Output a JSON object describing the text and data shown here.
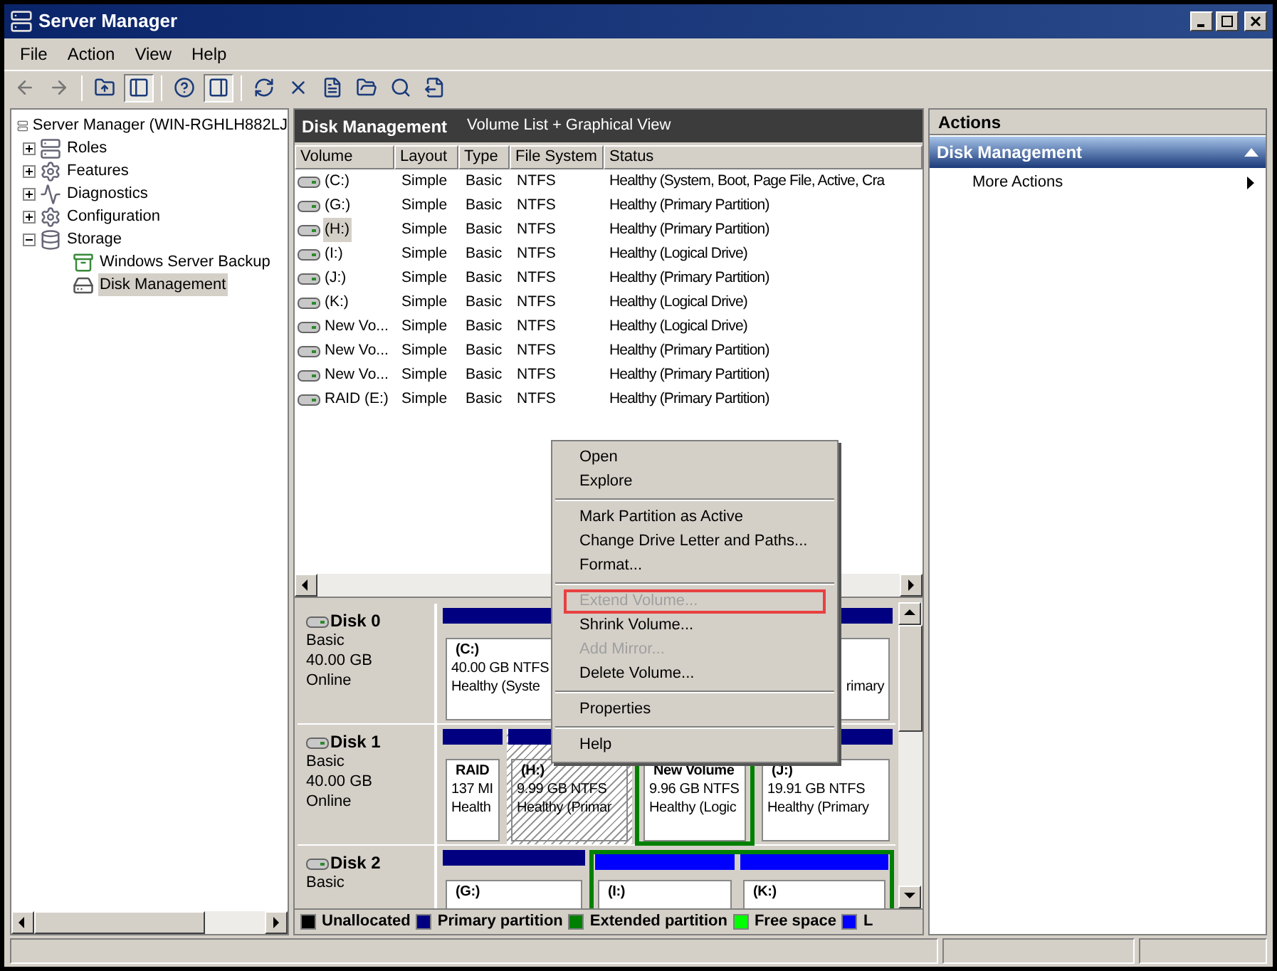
{
  "window": {
    "title": "Server Manager"
  },
  "menu_bar": [
    "File",
    "Action",
    "View",
    "Help"
  ],
  "toolbar": [
    {
      "kind": "back",
      "pressed": false
    },
    {
      "kind": "forward",
      "pressed": false
    },
    {
      "kind": "up",
      "pressed": false
    },
    {
      "kind": "tree",
      "pressed": true
    },
    {
      "kind": "help",
      "pressed": false
    },
    {
      "kind": "pane",
      "pressed": true
    },
    {
      "kind": "refresh",
      "pressed": false
    },
    {
      "kind": "delete",
      "pressed": false
    },
    {
      "kind": "properties",
      "pressed": false
    },
    {
      "kind": "open",
      "pressed": false
    },
    {
      "kind": "search",
      "pressed": false
    },
    {
      "kind": "export",
      "pressed": false
    }
  ],
  "tree": {
    "label": "Server Manager (WIN-RGHLH882LJ",
    "children": [
      {
        "label": "Roles",
        "expanded": false,
        "selected": false
      },
      {
        "label": "Features",
        "expanded": false,
        "selected": false
      },
      {
        "label": "Diagnostics",
        "expanded": false,
        "selected": false
      },
      {
        "label": "Configuration",
        "expanded": false,
        "selected": false
      },
      {
        "label": "Storage",
        "expanded": true,
        "selected": false,
        "children": [
          {
            "label": "Windows Server Backup",
            "selected": false
          },
          {
            "label": "Disk Management",
            "selected": true
          }
        ]
      }
    ]
  },
  "center": {
    "title": "Disk Management",
    "subtitle": "Volume List + Graphical View",
    "columns": [
      "Volume",
      "Layout",
      "Type",
      "File System",
      "Status"
    ],
    "rows": [
      {
        "cells": [
          "(C:)",
          "Simple",
          "Basic",
          "NTFS",
          "Healthy (System, Boot, Page File, Active, Cra"
        ],
        "selected": false
      },
      {
        "cells": [
          "(G:)",
          "Simple",
          "Basic",
          "NTFS",
          "Healthy (Primary Partition)"
        ],
        "selected": false
      },
      {
        "cells": [
          "(H:)",
          "Simple",
          "Basic",
          "NTFS",
          "Healthy (Primary Partition)"
        ],
        "selected": true
      },
      {
        "cells": [
          "(I:)",
          "Simple",
          "Basic",
          "NTFS",
          "Healthy (Logical Drive)"
        ],
        "selected": false
      },
      {
        "cells": [
          "(J:)",
          "Simple",
          "Basic",
          "NTFS",
          "Healthy (Primary Partition)"
        ],
        "selected": false
      },
      {
        "cells": [
          "(K:)",
          "Simple",
          "Basic",
          "NTFS",
          "Healthy (Logical Drive)"
        ],
        "selected": false
      },
      {
        "cells": [
          "New Vo...",
          "Simple",
          "Basic",
          "NTFS",
          "Healthy (Logical Drive)"
        ],
        "selected": false
      },
      {
        "cells": [
          "New Vo...",
          "Simple",
          "Basic",
          "NTFS",
          "Healthy (Primary Partition)"
        ],
        "selected": false
      },
      {
        "cells": [
          "New Vo...",
          "Simple",
          "Basic",
          "NTFS",
          "Healthy (Primary Partition)"
        ],
        "selected": false
      },
      {
        "cells": [
          "RAID (E:)",
          "Simple",
          "Basic",
          "NTFS",
          "Healthy (Primary Partition)"
        ],
        "selected": false
      }
    ],
    "disks": [
      {
        "name": "Disk 0",
        "lines": [
          "Basic",
          "40.00 GB",
          "Online"
        ],
        "partitions": [
          {
            "name": "(C:)",
            "size": "40.00 GB NTFS",
            "status": "Healthy (Syste",
            "logical": false,
            "extended": false,
            "selected": false
          },
          {
            "status": "rimary",
            "logical": false,
            "extended": false,
            "selected": false
          }
        ]
      },
      {
        "name": "Disk 1",
        "lines": [
          "Basic",
          "40.00 GB",
          "Online"
        ],
        "partitions": [
          {
            "name": "RAID",
            "size": "137 MI",
            "status": "Health",
            "logical": false,
            "extended": false,
            "selected": false
          },
          {
            "name": "(H:)",
            "size": "9.99 GB NTFS",
            "status": "Healthy (Primar",
            "logical": false,
            "extended": false,
            "selected": true
          },
          {
            "name": "New Volume",
            "size": "9.96 GB NTFS",
            "status": "Healthy (Logic",
            "extended": true,
            "selected": false
          },
          {
            "name": "(J:)",
            "size": "19.91 GB NTFS",
            "status": "Healthy (Primary",
            "logical": false,
            "extended": false,
            "selected": false
          }
        ]
      },
      {
        "name": "Disk 2",
        "lines": [
          "Basic"
        ],
        "partitions": [
          {
            "name": "(G:)",
            "logical": false,
            "extended": false,
            "selected": false
          },
          {
            "name": "(I:)",
            "logical": true,
            "extended": true,
            "selected": false
          },
          {
            "name": "(K:)",
            "logical": true,
            "extended": true,
            "selected": false
          }
        ]
      }
    ],
    "legend": [
      {
        "label": "Unallocated",
        "color": "#000000"
      },
      {
        "label": "Primary partition",
        "color": "#000080"
      },
      {
        "label": "Extended partition",
        "color": "#008000"
      },
      {
        "label": "Free space",
        "color": "#00ff00"
      },
      {
        "label": "L",
        "color": "#0000ff"
      }
    ]
  },
  "actions": {
    "title": "Actions",
    "section": "Disk Management",
    "items": [
      "More Actions"
    ]
  },
  "context_menu": [
    {
      "kind": "item",
      "label": "Open",
      "disabled": false,
      "highlighted": false
    },
    {
      "kind": "item",
      "label": "Explore",
      "disabled": false,
      "highlighted": false
    },
    {
      "kind": "separator"
    },
    {
      "kind": "item",
      "label": "Mark Partition as Active",
      "disabled": false,
      "highlighted": false
    },
    {
      "kind": "item",
      "label": "Change Drive Letter and Paths...",
      "disabled": false,
      "highlighted": false
    },
    {
      "kind": "item",
      "label": "Format...",
      "disabled": false,
      "highlighted": false
    },
    {
      "kind": "separator"
    },
    {
      "kind": "item",
      "label": "Extend Volume...",
      "disabled": true,
      "highlighted": true
    },
    {
      "kind": "item",
      "label": "Shrink Volume...",
      "disabled": false,
      "highlighted": false
    },
    {
      "kind": "item",
      "label": "Add Mirror...",
      "disabled": true,
      "highlighted": false
    },
    {
      "kind": "item",
      "label": "Delete Volume...",
      "disabled": false,
      "highlighted": false
    },
    {
      "kind": "separator"
    },
    {
      "kind": "item",
      "label": "Properties",
      "disabled": false,
      "highlighted": false
    },
    {
      "kind": "separator"
    },
    {
      "kind": "item",
      "label": "Help",
      "disabled": false,
      "highlighted": false
    }
  ]
}
